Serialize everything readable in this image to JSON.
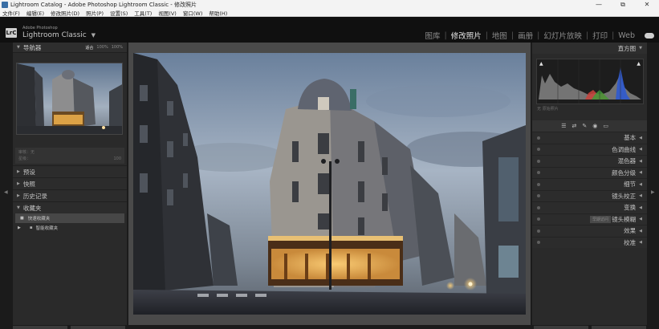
{
  "window": {
    "title": "Lightroom Catalog - Adobe Photoshop Lightroom Classic - 修改照片",
    "controls": [
      "—",
      "⧉",
      "✕"
    ]
  },
  "menu": [
    "文件(F)",
    "编辑(E)",
    "修改照片(D)",
    "照片(P)",
    "设置(S)",
    "工具(T)",
    "视图(V)",
    "窗口(W)",
    "帮助(H)"
  ],
  "identity": {
    "logo": "LrC",
    "vendor": "Adobe Photoshop",
    "product": "Lightroom Classic",
    "caret": "▼"
  },
  "modules": {
    "items": [
      "图库",
      "修改照片",
      "地图",
      "画册",
      "幻灯片放映",
      "打印",
      "Web"
    ],
    "active_index": 1,
    "separator": "|"
  },
  "navigator": {
    "title": "导航器",
    "options": [
      "适合",
      "100%",
      "100%"
    ],
    "active_option": 0
  },
  "collection_info": {
    "row1": [
      "审核：无",
      ""
    ],
    "row2": [
      "星级：",
      "100"
    ]
  },
  "left_sections": [
    {
      "label": "预设",
      "state": "collapsed"
    },
    {
      "label": "快照",
      "state": "collapsed"
    },
    {
      "label": "历史记录",
      "state": "collapsed"
    },
    {
      "label": "收藏夹",
      "state": "expanded"
    }
  ],
  "collections": [
    {
      "label": "快速收藏夹",
      "selected": true
    },
    {
      "label": "智能收藏夹",
      "selected": false
    }
  ],
  "histogram": {
    "title": "直方图",
    "exif": "无 原始照片"
  },
  "tool_icons": [
    "☰",
    "⇄",
    "✎",
    "◉",
    "▭",
    "◌"
  ],
  "right_sections": [
    {
      "label": "基本",
      "badge": ""
    },
    {
      "label": "色调曲线",
      "badge": ""
    },
    {
      "label": "混色器",
      "badge": ""
    },
    {
      "label": "颜色分级",
      "badge": ""
    },
    {
      "label": "细节",
      "badge": ""
    },
    {
      "label": "镜头校正",
      "badge": ""
    },
    {
      "label": "变换",
      "badge": ""
    },
    {
      "label": "镜头模糊",
      "badge": "早期访问"
    },
    {
      "label": "效果",
      "badge": ""
    },
    {
      "label": "校准",
      "badge": ""
    }
  ],
  "colors": {
    "panel_bg": "#2a2a2a",
    "center_bg": "#4a4a4a",
    "active_text": "#e6e6e6",
    "inactive_text": "#8c8c8c"
  }
}
